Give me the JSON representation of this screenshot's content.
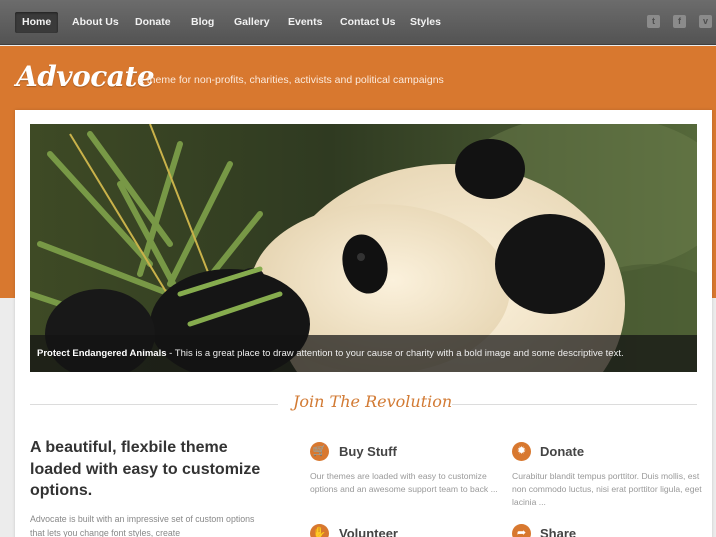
{
  "nav": {
    "items": [
      {
        "label": "Home",
        "active": true
      },
      {
        "label": "About Us",
        "active": false
      },
      {
        "label": "Donate",
        "active": false
      },
      {
        "label": "Blog",
        "active": false
      },
      {
        "label": "Gallery",
        "active": false
      },
      {
        "label": "Events",
        "active": false
      },
      {
        "label": "Contact Us",
        "active": false
      },
      {
        "label": "Styles",
        "active": false
      }
    ],
    "social": [
      {
        "icon": "twitter-icon",
        "glyph": "t"
      },
      {
        "icon": "facebook-icon",
        "glyph": "f"
      },
      {
        "icon": "vimeo-icon",
        "glyph": "v"
      }
    ]
  },
  "header": {
    "logo": "Advocate",
    "tagline": "a theme for non-profits, charities, activists and political campaigns",
    "accent_color": "#d8782f"
  },
  "hero": {
    "caption_title": "Protect Endangered Animals",
    "caption_text": " - This is a great place to draw attention to your cause or charity with a bold image and some descriptive text."
  },
  "section": {
    "title": "Join The Revolution"
  },
  "intro": {
    "heading": "A beautiful, flexbile theme loaded with easy to customize options.",
    "text": "Advocate is built with an impressive set of custom options that lets you change font styles, create"
  },
  "features": [
    {
      "icon": "cart-icon",
      "glyph": "🛒",
      "title": "Buy Stuff",
      "text": "Our themes are loaded with easy to customize options and an awesome support team to back ..."
    },
    {
      "icon": "lightbulb-icon",
      "glyph": "✹",
      "title": "Donate",
      "text": "Curabitur blandit tempus porttitor. Duis mollis, est non commodo luctus, nisi erat porttitor ligula, eget lacinia ..."
    },
    {
      "icon": "hand-icon",
      "glyph": "✋",
      "title": "Volunteer",
      "text": ""
    },
    {
      "icon": "share-icon",
      "glyph": "➦",
      "title": "Share",
      "text": ""
    }
  ]
}
